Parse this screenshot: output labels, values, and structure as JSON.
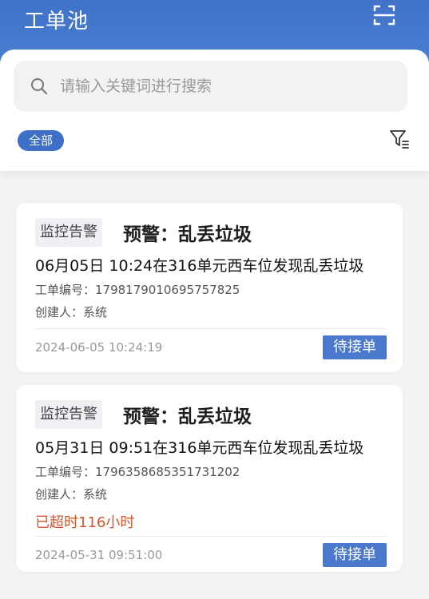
{
  "header": {
    "title": "工单池",
    "scan_icon": "scan-icon"
  },
  "search": {
    "placeholder": "请输入关键词进行搜索",
    "value": ""
  },
  "filters": {
    "active_chip": "全部",
    "filter_icon": "filter-icon"
  },
  "colors": {
    "brand": "#3e6fc6",
    "accent_button": "#4a78cc",
    "overdue": "#d8542b"
  },
  "tickets": [
    {
      "tag": "监控告警",
      "title": "预警：乱丢垃圾",
      "description": "06月05日 10:24在316单元西车位发现乱丢垃圾",
      "order_no": "工单编号：1798179010695757825",
      "creator": "创建人：系统",
      "overdue": "",
      "created_at": "2024-06-05 10:24:19",
      "action": "待接单"
    },
    {
      "tag": "监控告警",
      "title": "预警：乱丢垃圾",
      "description": "05月31日 09:51在316单元西车位发现乱丢垃圾",
      "order_no": "工单编号：1796358685351731202",
      "creator": "创建人：系统",
      "overdue": "已超时116小时",
      "created_at": "2024-05-31 09:51:00",
      "action": "待接单"
    }
  ]
}
